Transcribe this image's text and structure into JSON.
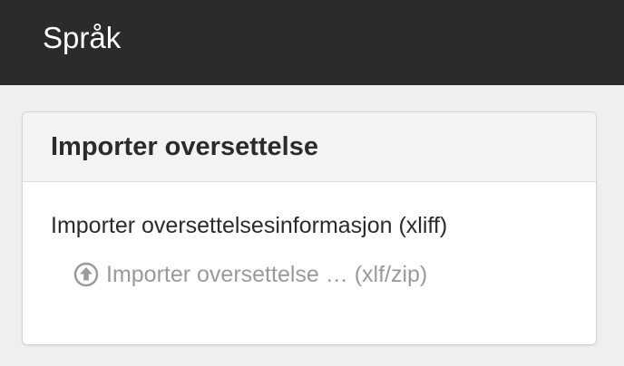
{
  "header": {
    "title": "Språk"
  },
  "panel": {
    "title": "Importer oversettelse",
    "section_label": "Importer oversettelsesinformasjon (xliff)",
    "import_link": {
      "label": "Importer oversettelse … (xlf/zip)",
      "icon": "upload-circle-icon",
      "state": "disabled"
    }
  },
  "colors": {
    "topbar_bg": "#2b2b2b",
    "page_bg": "#efefef",
    "panel_header_bg": "#f3f3f3",
    "disabled_text": "#9a9a9a"
  }
}
